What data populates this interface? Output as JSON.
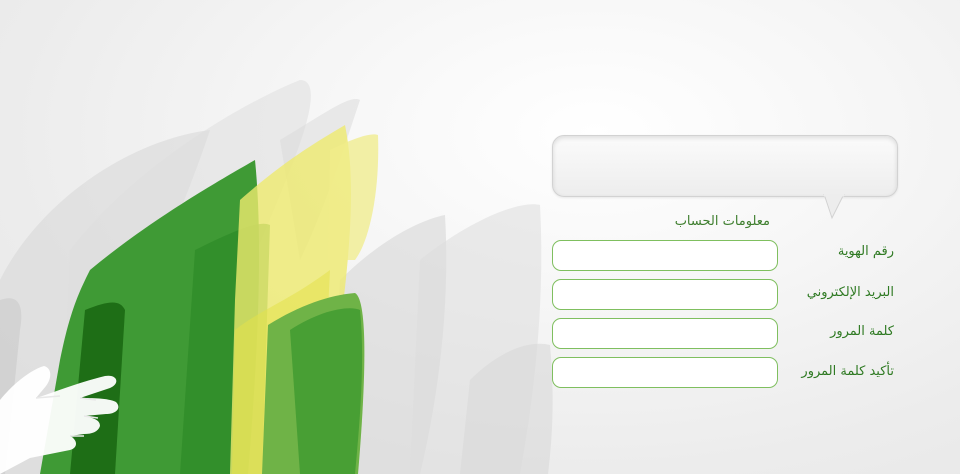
{
  "form": {
    "section_title": "معلومات الحساب",
    "fields": [
      {
        "label": "رقم الهوية",
        "value": "",
        "placeholder": ""
      },
      {
        "label": "البريد الإلكتروني",
        "value": "",
        "placeholder": ""
      },
      {
        "label": "كلمة المرور",
        "value": "",
        "placeholder": ""
      },
      {
        "label": "تأكيد كلمة المرور",
        "value": "",
        "placeholder": ""
      }
    ]
  },
  "bubble": {
    "text": ""
  },
  "colors": {
    "label_green": "#2f7a23",
    "input_border": "#7fbf5f",
    "dark_green": "#1e7a1a",
    "mid_green": "#4aa33a",
    "yellow": "#eeea7a"
  }
}
